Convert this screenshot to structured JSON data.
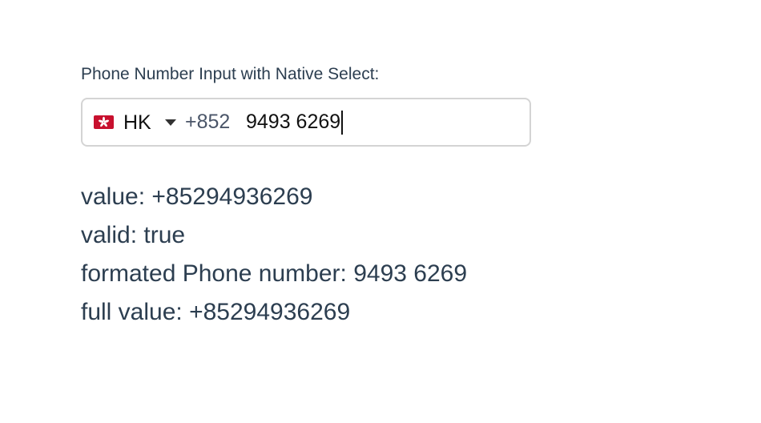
{
  "label": "Phone Number Input with Native Select:",
  "phone_input": {
    "country_flag_icon": "hong-kong-flag-icon",
    "country_code": "HK",
    "dial_code": "+852",
    "number_value": "9493 6269",
    "caret_icon": "caret-down-icon"
  },
  "results": {
    "value": "value: +85294936269",
    "valid": "valid: true",
    "formatted": "formated Phone number: 9493 6269",
    "full_value": "full value: +85294936269"
  },
  "colors": {
    "text": "#2c3e50",
    "border": "#d4d4d4",
    "flag_red": "#c8102e"
  }
}
